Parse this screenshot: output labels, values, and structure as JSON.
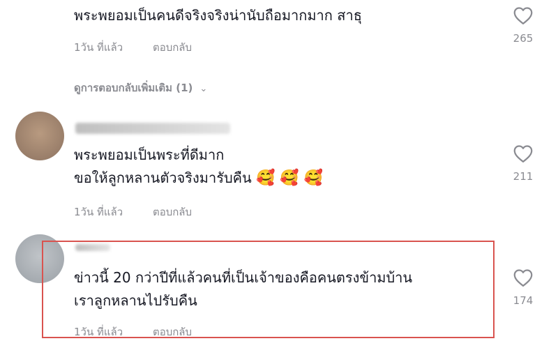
{
  "comments": [
    {
      "text_lines": [
        "พระพยอมเป็นคนดีจริงจริงน่านับถือมากมาก สาธุ"
      ],
      "time": "1วัน ที่แล้ว",
      "reply": "ตอบกลับ",
      "likes": "265",
      "more_replies": "ดูการตอบกลับเพิ่มเติม (1)"
    },
    {
      "text_lines": [
        "พระพยอมเป็นพระที่ดีมาก",
        "ขอให้ลูกหลานตัวจริงมารับคืน"
      ],
      "emojis": "🥰 🥰 🥰",
      "time": "1วัน ที่แล้ว",
      "reply": "ตอบกลับ",
      "likes": "211"
    },
    {
      "text_lines": [
        "ข่าวนี้ 20 กว่าปีที่แล้วคนที่เป็นเจ้าของคือคนตรงข้ามบ้าน",
        "เราลูกหลานไปรับคืน"
      ],
      "time": "1วัน ที่แล้ว",
      "reply": "ตอบกลับ",
      "likes": "174"
    }
  ],
  "colors": {
    "text": "#161823",
    "meta": "#8a8b91",
    "highlight_border": "#d9534f"
  },
  "icons": {
    "like": "heart-outline-icon",
    "expand": "chevron-down-icon"
  }
}
